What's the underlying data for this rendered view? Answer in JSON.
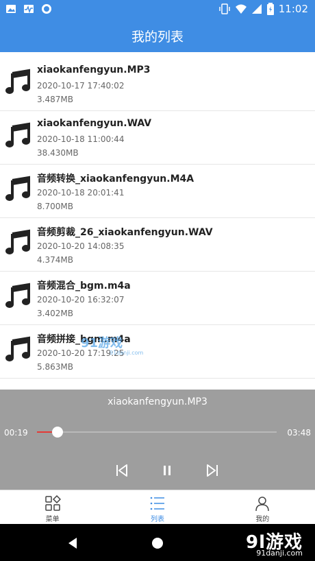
{
  "status_bar": {
    "time": "11:02",
    "colors": {
      "bar": "#3f8de4"
    }
  },
  "app_bar": {
    "title": "我的列表"
  },
  "files": [
    {
      "name": "xiaokanfengyun.MP3",
      "date": "2020-10-17 17:40:02",
      "size": "3.487MB"
    },
    {
      "name": "xiaokanfengyun.WAV",
      "date": "2020-10-18 11:00:44",
      "size": "38.430MB"
    },
    {
      "name": "音频转换_xiaokanfengyun.M4A",
      "date": "2020-10-18 20:01:41",
      "size": "8.700MB"
    },
    {
      "name": "音频剪裁_26_xiaokanfengyun.WAV",
      "date": "2020-10-20 14:08:35",
      "size": "4.374MB"
    },
    {
      "name": "音频混合_bgm.m4a",
      "date": "2020-10-20 16:32:07",
      "size": "3.402MB"
    },
    {
      "name": "音频拼接_bgm.m4a",
      "date": "2020-10-20 17:19:25",
      "size": "5.863MB"
    }
  ],
  "player": {
    "title": "xiaokanfengyun.MP3",
    "current_time": "00:19",
    "total_time": "03:48",
    "progress_fraction": 0.086,
    "buttons": {
      "prev": "prev-icon",
      "pause": "pause-icon",
      "next": "next-icon"
    },
    "colors": {
      "background": "#9e9e9e",
      "played": "#e53935"
    }
  },
  "bottom_nav": {
    "tabs": [
      {
        "label": "菜单",
        "icon": "grid-icon"
      },
      {
        "label": "列表",
        "icon": "list-icon",
        "active": true
      },
      {
        "label": "我的",
        "icon": "person-icon"
      }
    ],
    "active_color": "#3f8de4"
  },
  "watermark": {
    "brand": "9l游戏",
    "site": "91danji.com",
    "overlay_site": "91danji.com"
  }
}
